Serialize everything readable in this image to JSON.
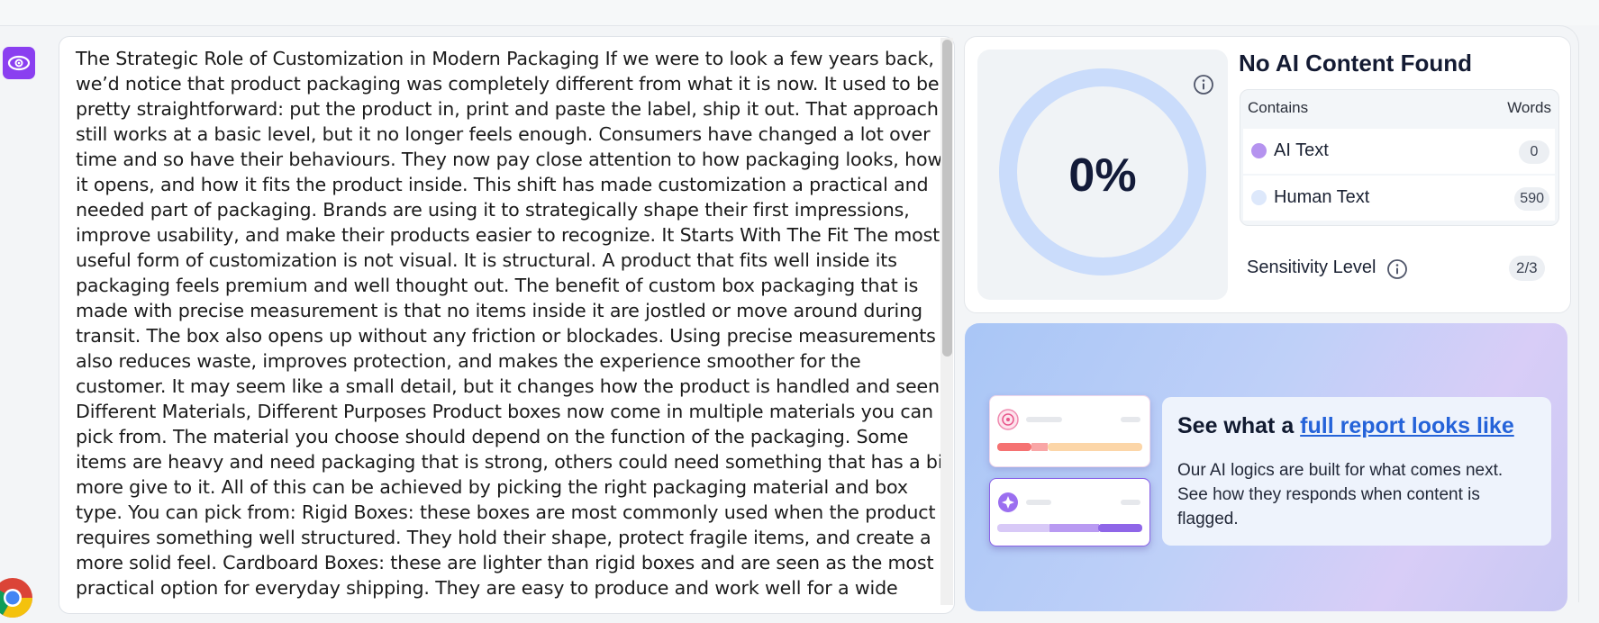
{
  "content": {
    "lines": [
      "The Strategic Role of Customization in Modern Packaging If we were to look a few years back,",
      "we’d notice that product packaging was completely different from what it is now. It used to be",
      "pretty straightforward: put the product in, print and paste the label, ship it out. That approach",
      "still works at a basic level, but it no longer feels enough. Consumers have changed a lot over",
      "time and so have their behaviours. They now pay close attention to how packaging looks, how",
      "it opens, and how it fits the product inside. This shift has made customization a practical and",
      "needed part of packaging. Brands are using it to strategically shape their first impressions,",
      "improve usability, and make their products easier to recognize. It Starts With The Fit The most",
      "useful form of customization is not visual. It is structural. A product that fits well inside its",
      "packaging feels premium and well thought out. The benefit of custom box packaging that is",
      "made with precise measurement is that no items inside it are jostled or move around during",
      "transit. The box also opens up without any friction or blockades. Using precise measurements",
      "also reduces waste, improves protection, and makes the experience smoother for the",
      "customer. It may seem like a small detail, but it changes how the product is handled and seen.",
      "Different Materials, Different Purposes Product boxes now come in multiple materials you can",
      "pick from. The material you choose should depend on the function of the packaging. Some",
      "items are heavy and need packaging that is strong, others could need something that has a bit",
      "more give to it. All of this can be achieved by picking the right packaging material and box",
      "type. You can pick from: Rigid Boxes: these boxes are most commonly used when the product",
      "requires something well structured. They hold their shape, protect fragile items, and create a",
      "more solid feel. Cardboard Boxes: these are lighter than rigid boxes and are seen as the most",
      "practical option for everyday shipping. They are easy to produce and work well for a wide"
    ]
  },
  "result": {
    "percent": "0%",
    "ai_fraction": 0,
    "title": "No AI Content Found",
    "col_contains": "Contains",
    "col_words": "Words",
    "rows": [
      {
        "label": "AI Text",
        "count": "0"
      },
      {
        "label": "Human Text",
        "count": "590"
      }
    ],
    "sensitivity_label": "Sensitivity Level",
    "sensitivity_value": "2/3"
  },
  "promo": {
    "title_prefix": "See what a ",
    "title_link": "full report looks like",
    "text": "Our AI logics are built for what comes next. See how they responds when content is flagged."
  },
  "colors": {
    "brand": "#8a3ff0",
    "ai_dot": "#b593ef",
    "human_dot": "#dde8fb",
    "gauge_ring": "#cadcfb",
    "link": "#2563d9"
  },
  "icons": [
    "ai-detector-logo-icon",
    "chrome-icon",
    "info-icon",
    "pie-chart-icon",
    "sparkle-icon"
  ]
}
